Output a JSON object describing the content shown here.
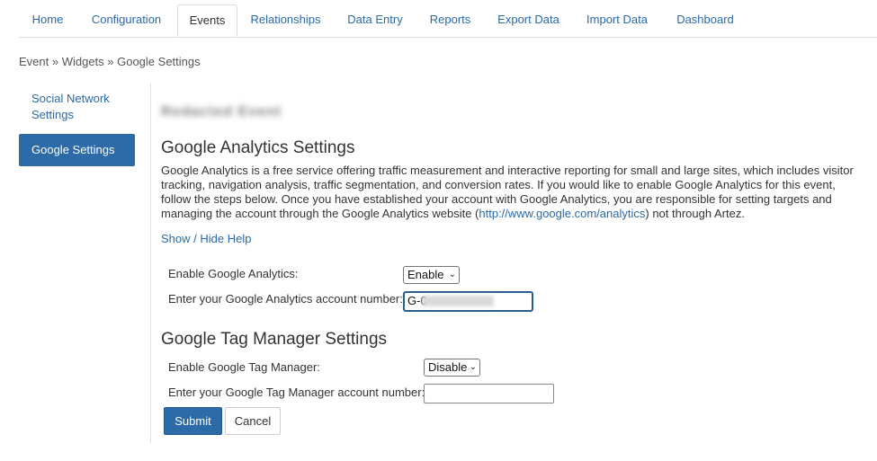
{
  "tabs": {
    "home": "Home",
    "configuration": "Configuration",
    "events": "Events",
    "relationships": "Relationships",
    "data_entry": "Data Entry",
    "reports": "Reports",
    "export_data": "Export Data",
    "import_data": "Import Data",
    "dashboard": "Dashboard",
    "active": "Events"
  },
  "breadcrumb": "Event » Widgets » Google Settings",
  "sidebar": {
    "social_line1": "Social Network",
    "social_line2": "Settings",
    "google": "Google Settings"
  },
  "blurred_header": "Redacted Event",
  "analytics": {
    "title": "Google Analytics Settings",
    "description_pre": "Google Analytics is a free service offering traffic measurement and interactive reporting for small and large sites, which includes visitor tracking, navigation analysis, traffic segmentation, and conversion rates. If you would like to enable Google Analytics for this event, follow the steps below. Once you have established your account with Google Analytics, you are responsible for setting targets and managing the account through the Google Analytics website (",
    "description_link": "http://www.google.com/analytics",
    "description_post": ") not through Artez.",
    "help_link": "Show / Hide Help",
    "enable_label": "Enable Google Analytics:",
    "enable_value": "Enable",
    "account_label": "Enter your Google Analytics account number:",
    "account_value": "G-0"
  },
  "tag_manager": {
    "title": "Google Tag Manager Settings",
    "enable_label": "Enable Google Tag Manager:",
    "enable_value": "Disable",
    "account_label": "Enter your Google Tag Manager account number:",
    "account_value": ""
  },
  "buttons": {
    "submit": "Submit",
    "cancel": "Cancel"
  }
}
